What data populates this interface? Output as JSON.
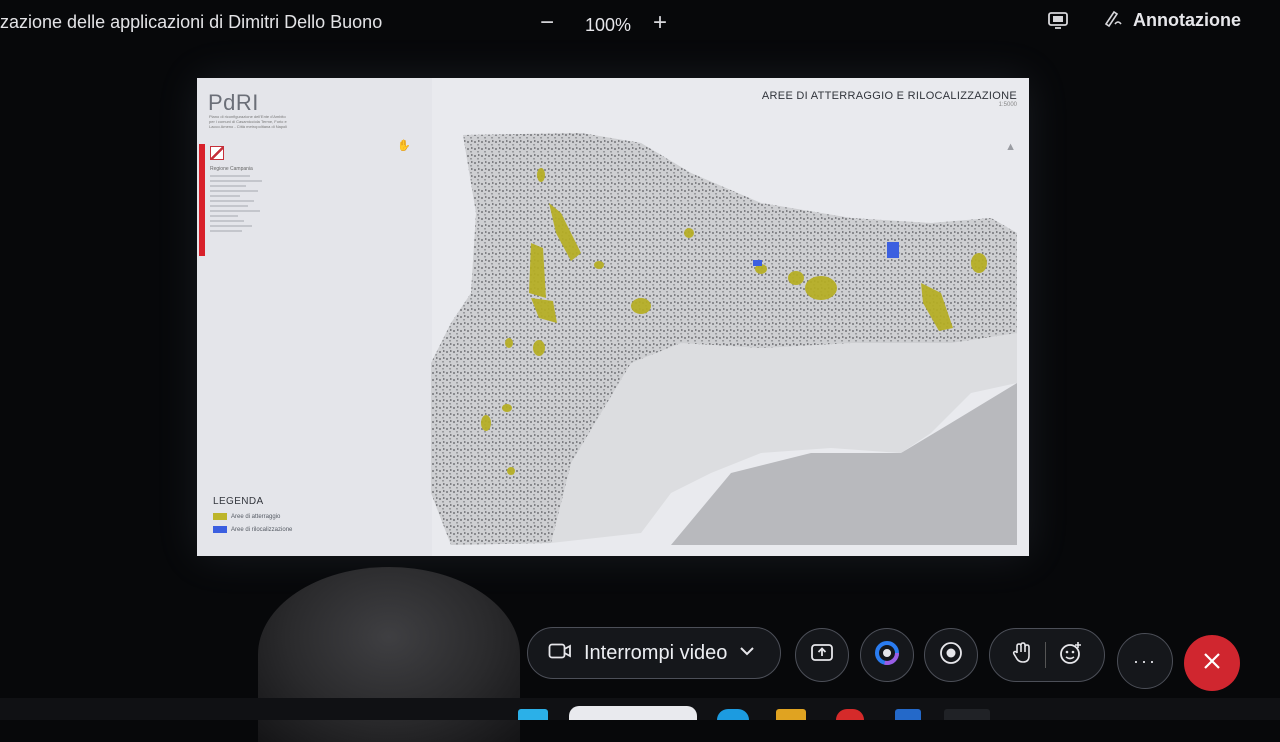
{
  "topbar": {
    "title": "zazione delle applicazioni di Dimitri Dello Buono",
    "zoom_minus": "−",
    "zoom_level": "100%",
    "zoom_plus": "+",
    "annotation_label": "Annotazione"
  },
  "slide": {
    "logo": "PdRI",
    "logo_subtitle": "Piano di riconfigurazione dell'Ente d'Ambito per i comuni di Casamicciola Terme, Forio e Lacco Ameno - Città metropolitana di Napoli",
    "region_name": "Regione Campania",
    "map_title": "AREE DI ATTERRAGGIO E RILOCALIZZAZIONE",
    "map_scale": "1:5000",
    "legend": {
      "title": "LEGENDA",
      "items": [
        {
          "label": "Aree di atterraggio",
          "color": "#bdb52a"
        },
        {
          "label": "Aree di rilocalizzazione",
          "color": "#3b5fe0"
        }
      ]
    }
  },
  "controls": {
    "video_label": "Interrompi video",
    "accent_blue": "#2a7cf0",
    "end_call_color": "#d0262f"
  }
}
